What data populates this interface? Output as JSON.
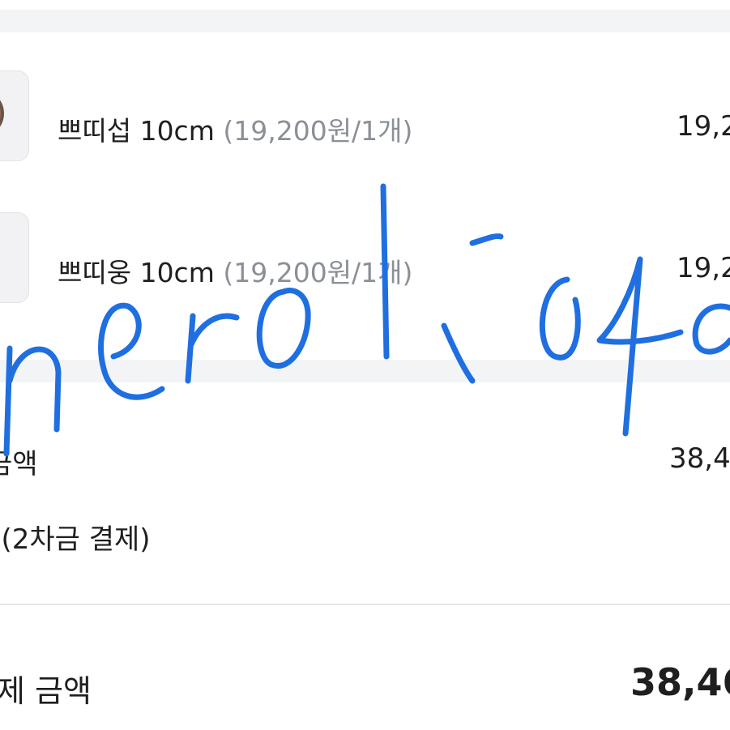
{
  "items": [
    {
      "name": "쁘띠섭 10cm",
      "unit_price": "(19,200원/1개)",
      "price": "19,2"
    },
    {
      "name": "쁘띠웅 10cm",
      "unit_price": "(19,200원/1개)",
      "price": "19,2"
    }
  ],
  "summary": {
    "amount_label": "금액",
    "amount_value": "38,4",
    "payment_note": "l(2차금 결제)"
  },
  "total": {
    "label": "제 금액",
    "value": "38,46"
  },
  "watermark": {
    "text": "nerolioua",
    "color": "#1f6fe0"
  },
  "colors": {
    "band": "#f3f4f6",
    "muted_text": "#8b8f96",
    "text": "#1f1f1f"
  }
}
